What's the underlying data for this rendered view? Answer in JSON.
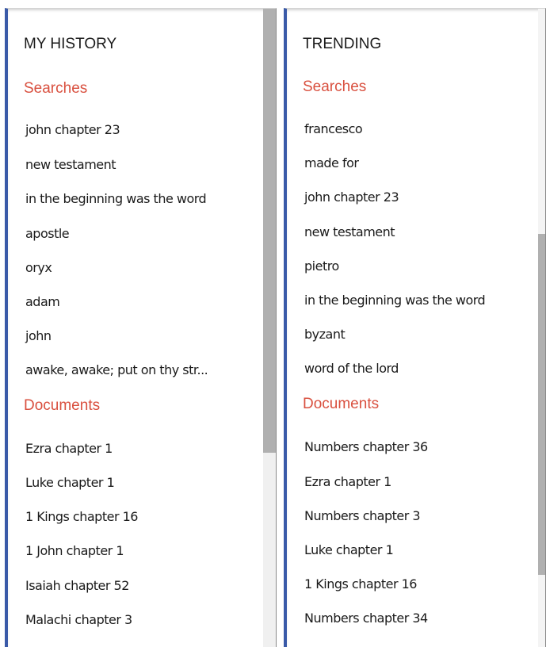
{
  "history": {
    "title": "MY HISTORY",
    "searches_heading": "Searches",
    "searches": [
      "john chapter 23",
      "new testament",
      "in the beginning was the word",
      "apostle",
      "oryx",
      "adam",
      "john",
      "awake, awake; put on thy str..."
    ],
    "documents_heading": "Documents",
    "documents": [
      "Ezra chapter 1",
      "Luke chapter 1",
      "1 Kings chapter 16",
      "1 John chapter 1",
      "Isaiah chapter 52",
      "Malachi chapter 3"
    ]
  },
  "trending": {
    "title": "TRENDING",
    "searches_heading": "Searches",
    "searches": [
      "francesco",
      "made for",
      "john chapter 23",
      "new testament",
      "pietro",
      "in the beginning was the word",
      "byzant",
      "word of the lord"
    ],
    "documents_heading": "Documents",
    "documents": [
      "Numbers chapter 36",
      "Ezra chapter 1",
      "Numbers chapter 3",
      "Luke chapter 1",
      "1 Kings chapter 16",
      "Numbers chapter 34"
    ]
  },
  "colors": {
    "accent_border": "#3a5aa8",
    "section_heading": "#d9503f",
    "text": "#1a1a1a"
  }
}
